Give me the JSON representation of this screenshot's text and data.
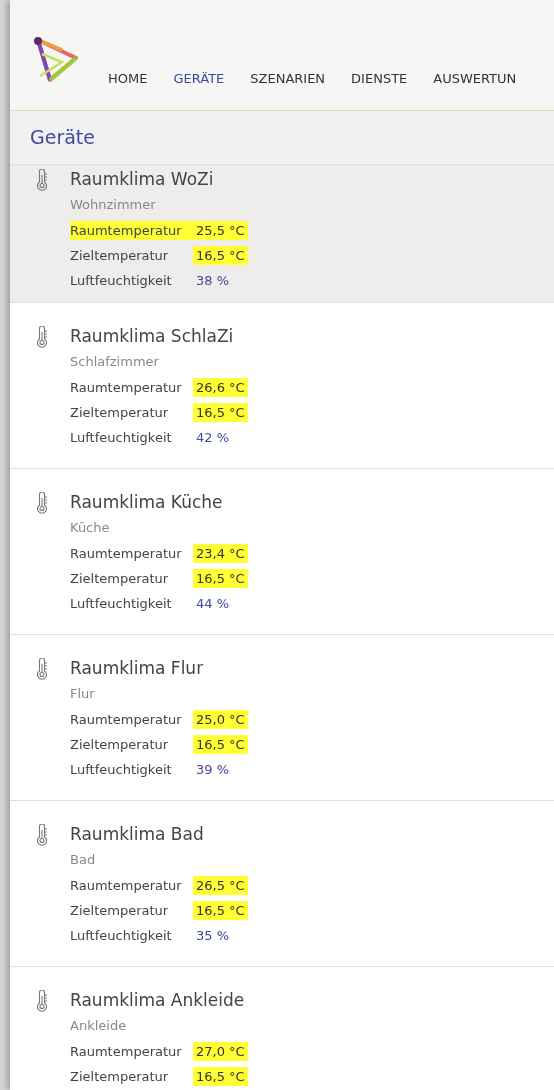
{
  "nav": {
    "items": [
      {
        "label": "HOME",
        "selected": false
      },
      {
        "label": "GERÄTE",
        "selected": true
      },
      {
        "label": "SZENARIEN",
        "selected": false
      },
      {
        "label": "DIENSTE",
        "selected": false
      },
      {
        "label": "AUSWERTUN",
        "selected": false
      }
    ]
  },
  "page_title": "Geräte",
  "devices": [
    {
      "title": "Raumklima WoZi",
      "room": "Wohnzimmer",
      "selected": true,
      "readings": [
        {
          "kind": "temperature",
          "label": "Raumtemperatur",
          "value": "25,5 °C",
          "label_highlighted": true,
          "value_highlighted": true
        },
        {
          "kind": "temperature",
          "label": "Zieltemperatur",
          "value": "16,5 °C",
          "label_highlighted": false,
          "value_highlighted": true
        },
        {
          "kind": "humidity",
          "label": "Luftfeuchtigkeit",
          "value": "38 %",
          "label_highlighted": false,
          "value_highlighted": false
        }
      ]
    },
    {
      "title": "Raumklima SchlaZi",
      "room": "Schlafzimmer",
      "selected": false,
      "readings": [
        {
          "kind": "temperature",
          "label": "Raumtemperatur",
          "value": "26,6 °C",
          "label_highlighted": false,
          "value_highlighted": true
        },
        {
          "kind": "temperature",
          "label": "Zieltemperatur",
          "value": "16,5 °C",
          "label_highlighted": false,
          "value_highlighted": true
        },
        {
          "kind": "humidity",
          "label": "Luftfeuchtigkeit",
          "value": "42 %",
          "label_highlighted": false,
          "value_highlighted": false
        }
      ]
    },
    {
      "title": "Raumklima Küche",
      "room": "Küche",
      "selected": false,
      "readings": [
        {
          "kind": "temperature",
          "label": "Raumtemperatur",
          "value": "23,4 °C",
          "label_highlighted": false,
          "value_highlighted": true
        },
        {
          "kind": "temperature",
          "label": "Zieltemperatur",
          "value": "16,5 °C",
          "label_highlighted": false,
          "value_highlighted": true
        },
        {
          "kind": "humidity",
          "label": "Luftfeuchtigkeit",
          "value": "44 %",
          "label_highlighted": false,
          "value_highlighted": false
        }
      ]
    },
    {
      "title": "Raumklima Flur",
      "room": "Flur",
      "selected": false,
      "readings": [
        {
          "kind": "temperature",
          "label": "Raumtemperatur",
          "value": "25,0 °C",
          "label_highlighted": false,
          "value_highlighted": true
        },
        {
          "kind": "temperature",
          "label": "Zieltemperatur",
          "value": "16,5 °C",
          "label_highlighted": false,
          "value_highlighted": true
        },
        {
          "kind": "humidity",
          "label": "Luftfeuchtigkeit",
          "value": "39 %",
          "label_highlighted": false,
          "value_highlighted": false
        }
      ]
    },
    {
      "title": "Raumklima Bad",
      "room": "Bad",
      "selected": false,
      "readings": [
        {
          "kind": "temperature",
          "label": "Raumtemperatur",
          "value": "26,5 °C",
          "label_highlighted": false,
          "value_highlighted": true
        },
        {
          "kind": "temperature",
          "label": "Zieltemperatur",
          "value": "16,5 °C",
          "label_highlighted": false,
          "value_highlighted": true
        },
        {
          "kind": "humidity",
          "label": "Luftfeuchtigkeit",
          "value": "35 %",
          "label_highlighted": false,
          "value_highlighted": false
        }
      ]
    },
    {
      "title": "Raumklima Ankleide",
      "room": "Ankleide",
      "selected": false,
      "readings": [
        {
          "kind": "temperature",
          "label": "Raumtemperatur",
          "value": "27,0 °C",
          "label_highlighted": false,
          "value_highlighted": true
        },
        {
          "kind": "temperature",
          "label": "Zieltemperatur",
          "value": "16,5 °C",
          "label_highlighted": false,
          "value_highlighted": true
        }
      ]
    }
  ]
}
